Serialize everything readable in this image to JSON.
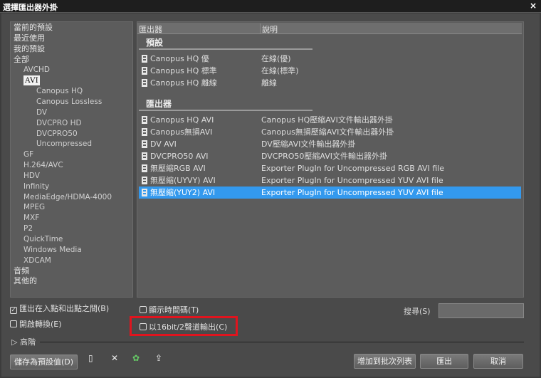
{
  "window": {
    "title": "選擇匯出器外掛",
    "close": "×"
  },
  "tree": [
    {
      "label": "當前的預設",
      "level": 0
    },
    {
      "label": "最近使用",
      "level": 0
    },
    {
      "label": "我的預設",
      "level": 0
    },
    {
      "label": "全部",
      "level": 0
    },
    {
      "label": "AVCHD",
      "level": 1
    },
    {
      "label": "AVI",
      "level": 1,
      "selected": true
    },
    {
      "label": "Canopus HQ",
      "level": 2
    },
    {
      "label": "Canopus Lossless",
      "level": 2
    },
    {
      "label": "DV",
      "level": 2
    },
    {
      "label": "DVCPRO HD",
      "level": 2
    },
    {
      "label": "DVCPRO50",
      "level": 2
    },
    {
      "label": "Uncompressed",
      "level": 2
    },
    {
      "label": "GF",
      "level": 1
    },
    {
      "label": "H.264/AVC",
      "level": 1
    },
    {
      "label": "HDV",
      "level": 1
    },
    {
      "label": "Infinity",
      "level": 1
    },
    {
      "label": "MediaEdge/HDMA-4000",
      "level": 1
    },
    {
      "label": "MPEG",
      "level": 1
    },
    {
      "label": "MXF",
      "level": 1
    },
    {
      "label": "P2",
      "level": 1
    },
    {
      "label": "QuickTime",
      "level": 1
    },
    {
      "label": "Windows Media",
      "level": 1
    },
    {
      "label": "XDCAM",
      "level": 1
    },
    {
      "label": "音頻",
      "level": 0
    },
    {
      "label": "其他的",
      "level": 0
    }
  ],
  "list": {
    "columns": [
      "匯出器",
      "說明"
    ],
    "sections": [
      {
        "title": "預設",
        "rows": [
          {
            "name": "Canopus HQ 優",
            "desc": "在線(優)"
          },
          {
            "name": "Canopus HQ 標準",
            "desc": "在線(標準)"
          },
          {
            "name": "Canopus HQ 離線",
            "desc": "離線"
          }
        ]
      },
      {
        "title": "匯出器",
        "rows": [
          {
            "name": "Canopus HQ AVI",
            "desc": "Canopus HQ壓縮AVI文件輸出器外掛"
          },
          {
            "name": "Canopus無損AVI",
            "desc": "Canopus無損壓縮AVI文件輸出器外掛"
          },
          {
            "name": "DV AVI",
            "desc": "DV壓縮AVI文件輸出器外掛"
          },
          {
            "name": "DVCPRO50 AVI",
            "desc": "DVCPRO50壓縮AVI文件輸出器外掛"
          },
          {
            "name": "無壓縮RGB AVI",
            "desc": "Exporter PlugIn for Uncompressed RGB AVI file"
          },
          {
            "name": "無壓縮(UYVY) AVI",
            "desc": "Exporter PlugIn for Uncompressed YUV AVI file"
          },
          {
            "name": "無壓縮(YUY2) AVI",
            "desc": "Exporter PlugIn for Uncompressed YUV AVI file",
            "selected": true
          }
        ]
      }
    ]
  },
  "options": {
    "inout": {
      "label": "匯出在入點和出點之間(B)",
      "checked": true
    },
    "convert": {
      "label": "開啟轉換(E)",
      "checked": false
    },
    "timecode": {
      "label": "顯示時間碼(T)",
      "checked": false
    },
    "audio16": {
      "label": "以16bit/2聲道輸出(C)",
      "checked": false
    },
    "search_label": "搜尋(S)",
    "search_value": "",
    "advanced": "高階"
  },
  "buttons": {
    "save_preset": "儲存為預設值(D)",
    "add_batch": "增加到批次列表",
    "export": "匯出",
    "cancel": "取消"
  },
  "colors": {
    "selection": "#3399ee",
    "highlight": "#e0141e"
  }
}
